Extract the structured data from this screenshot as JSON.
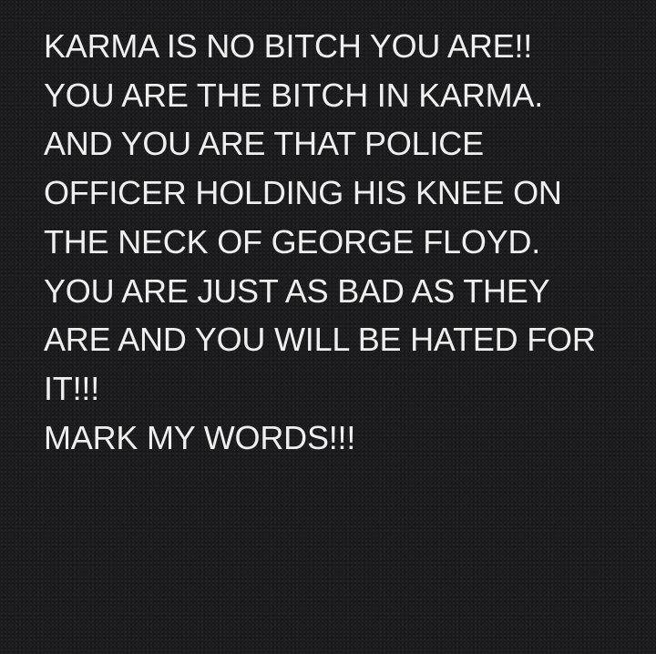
{
  "note": {
    "lines": [
      "KARMA IS NO BITCH YOU ARE!!",
      "YOU ARE THE BITCH IN KARMA.",
      "AND YOU ARE THAT POLICE",
      "OFFICER HOLDING HIS KNEE ON",
      "THE NECK OF GEORGE FLOYD.",
      "YOU ARE JUST AS BAD AS THEY",
      "ARE AND YOU WILL BE HATED FOR",
      "IT!!!",
      "MARK MY WORDS!!!"
    ]
  },
  "colors": {
    "background": "#1c1c1e",
    "text": "#efefef"
  }
}
